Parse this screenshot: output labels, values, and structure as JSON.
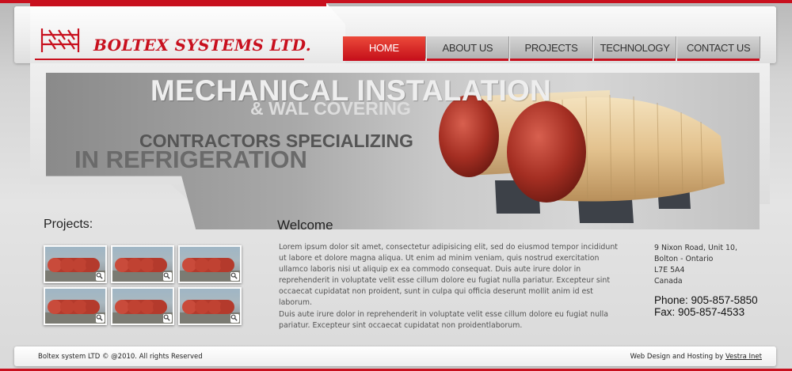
{
  "brand": {
    "name": "BOLTEX SYSTEMS LTD.",
    "accent": "#c8101e",
    "logo_icon": "pipe-rack-icon"
  },
  "nav": {
    "items": [
      {
        "label": "HOME",
        "active": true
      },
      {
        "label": "ABOUT US",
        "active": false
      },
      {
        "label": "PROJECTS",
        "active": false
      },
      {
        "label": "TECHNOLOGY",
        "active": false
      },
      {
        "label": "CONTACT US",
        "active": false
      }
    ]
  },
  "banner": {
    "line1": "MECHANICAL INSTALATION",
    "line2": "& WAL COVERING",
    "line3": "CONTRACTORS SPECIALIZING",
    "line4": "IN REFRIGERATION"
  },
  "projects": {
    "title": "Projects:",
    "thumb_icon": "zoom-icon",
    "thumb_count": 6
  },
  "welcome": {
    "title": "Welcome",
    "paragraph1": "Lorem ipsum dolor sit amet, consectetur adipisicing elit, sed do eiusmod tempor incididunt ut labore et dolore magna aliqua. Ut enim ad minim veniam, quis nostrud exercitation ullamco laboris nisi ut aliquip ex ea commodo consequat. Duis aute irure dolor in reprehenderit in voluptate velit esse cillum dolore eu fugiat nulla pariatur. Excepteur sint occaecat cupidatat non proident, sunt in culpa qui officia deserunt mollit anim id est laborum.",
    "paragraph2": "Duis aute irure dolor in reprehenderit in voluptate velit esse cillum dolore eu fugiat nulla pariatur. Excepteur sint occaecat cupidatat non proidentlaborum."
  },
  "contact": {
    "address_line1": "9 Nixon Road, Unit 10,",
    "address_line2": "Bolton - Ontario",
    "address_line3": "L7E 5A4",
    "address_line4": "Canada",
    "phone": "Phone: 905-857-5850",
    "fax": "Fax: 905-857-4533"
  },
  "footer": {
    "copyright": "Boltex system LTD © @2010. All rights Reserved",
    "credit_prefix": "Web Design and Hosting by",
    "credit_link": "Vestra Inet"
  }
}
